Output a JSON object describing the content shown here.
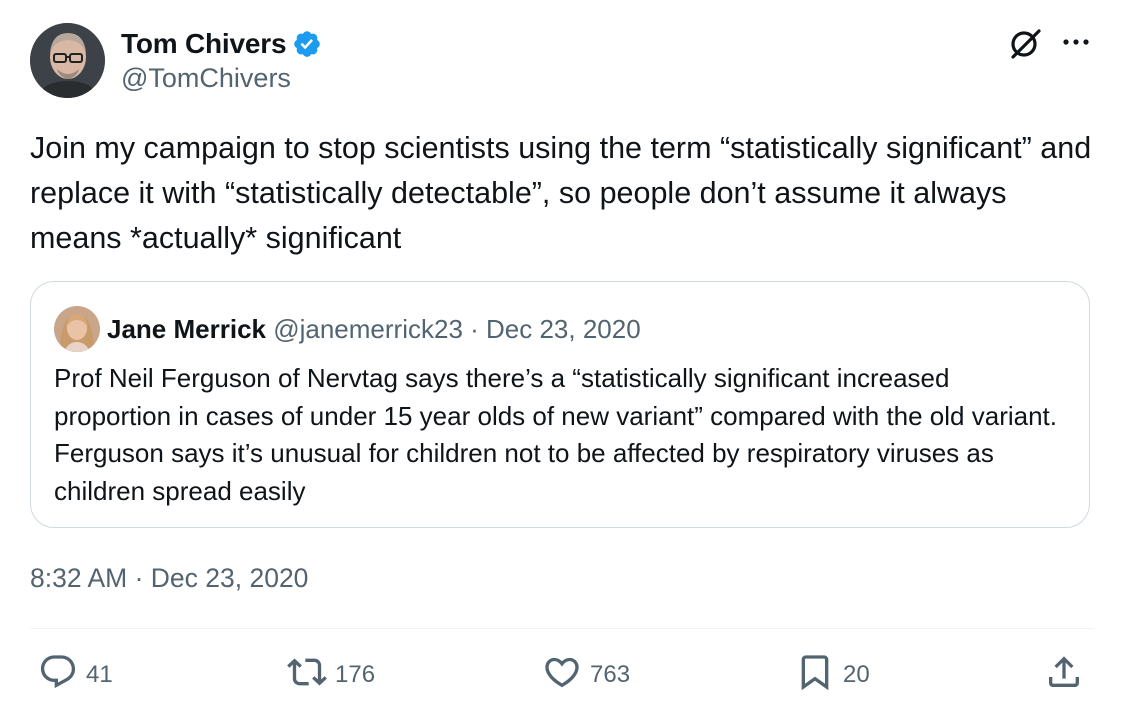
{
  "author": {
    "name": "Tom Chivers",
    "handle": "@TomChivers"
  },
  "tweet": {
    "text": "Join my campaign to stop scientists using the term “statistically significant” and replace it with “statistically detectable”, so people don’t assume it always means *actually* significant",
    "timestamp": "8:32 AM · Dec 23, 2020"
  },
  "quote": {
    "name": "Jane Merrick",
    "handle_date": "@janemerrick23 · Dec 23, 2020",
    "text": "Prof Neil Ferguson of Nervtag says there’s a “statistically significant increased proportion in cases of under 15 year olds of new variant” compared with the old variant. Ferguson says it’s unusual for children not to be affected by respiratory viruses as children spread easily"
  },
  "actions": {
    "replies": "41",
    "retweets": "176",
    "likes": "763",
    "bookmarks": "20"
  },
  "icons": {
    "verified": "verified-badge-icon",
    "grok": "grok-icon",
    "more": "more-icon",
    "reply": "reply-icon",
    "retweet": "retweet-icon",
    "like": "heart-icon",
    "bookmark": "bookmark-icon",
    "share": "share-icon"
  },
  "colors": {
    "verified": "#1d9bf0",
    "text": "#0f1419",
    "secondary": "#536471",
    "border": "#cfd9de"
  }
}
